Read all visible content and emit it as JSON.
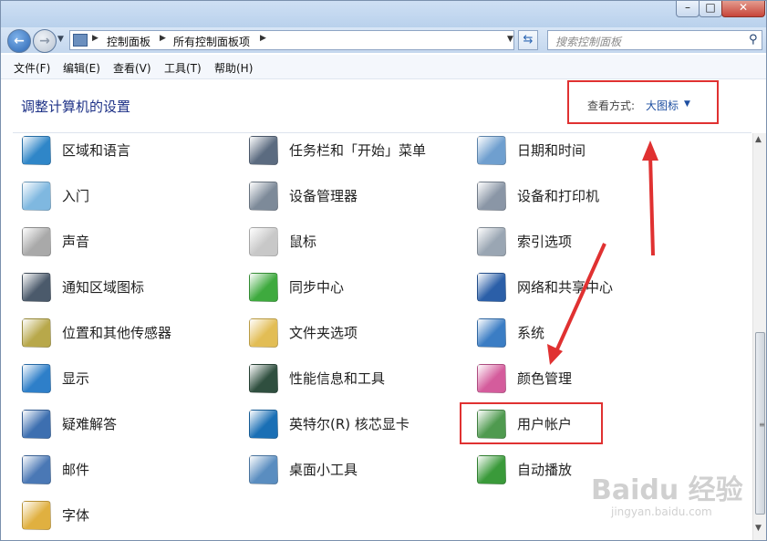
{
  "window": {
    "minimize_label": "–",
    "maximize_label": "□",
    "close_label": "✕"
  },
  "navigation": {
    "back_icon": "back-arrow-icon",
    "forward_icon": "forward-arrow-icon",
    "breadcrumbs": [
      "控制面板",
      "所有控制面板项"
    ],
    "search_placeholder": "搜索控制面板"
  },
  "menu": [
    "文件(F)",
    "编辑(E)",
    "查看(V)",
    "工具(T)",
    "帮助(H)"
  ],
  "header": {
    "title": "调整计算机的设置",
    "view_label": "查看方式:",
    "view_value": "大图标"
  },
  "items": [
    {
      "label": "区域和语言",
      "icon": "globe-clock-icon",
      "color": "#2f86c8"
    },
    {
      "label": "任务栏和「开始」菜单",
      "icon": "taskbar-icon",
      "color": "#5b6b80"
    },
    {
      "label": "日期和时间",
      "icon": "calendar-clock-icon",
      "color": "#6f9fcf"
    },
    {
      "label": "入门",
      "icon": "getting-started-icon",
      "color": "#7fb8e0"
    },
    {
      "label": "设备管理器",
      "icon": "device-manager-icon",
      "color": "#7d8a99"
    },
    {
      "label": "设备和打印机",
      "icon": "printer-icon",
      "color": "#8a96a6"
    },
    {
      "label": "声音",
      "icon": "speaker-icon",
      "color": "#a9a9a9"
    },
    {
      "label": "鼠标",
      "icon": "mouse-icon",
      "color": "#c8c8c8"
    },
    {
      "label": "索引选项",
      "icon": "magnifier-icon",
      "color": "#9aa6b3"
    },
    {
      "label": "通知区域图标",
      "icon": "notification-area-icon",
      "color": "#4b5a6b"
    },
    {
      "label": "同步中心",
      "icon": "sync-icon",
      "color": "#3eaa3e"
    },
    {
      "label": "网络和共享中心",
      "icon": "network-icon",
      "color": "#2b5fa8"
    },
    {
      "label": "位置和其他传感器",
      "icon": "sensor-icon",
      "color": "#b8a84a"
    },
    {
      "label": "文件夹选项",
      "icon": "folder-options-icon",
      "color": "#e2bd55"
    },
    {
      "label": "系统",
      "icon": "system-monitor-icon",
      "color": "#3b7dc4"
    },
    {
      "label": "显示",
      "icon": "display-icon",
      "color": "#2e7fc9"
    },
    {
      "label": "性能信息和工具",
      "icon": "performance-icon",
      "color": "#2f4f3f"
    },
    {
      "label": "颜色管理",
      "icon": "color-management-icon",
      "color": "#d45c9c"
    },
    {
      "label": "疑难解答",
      "icon": "troubleshoot-icon",
      "color": "#3d6fb0"
    },
    {
      "label": "英特尔(R) 核芯显卡",
      "icon": "intel-graphics-icon",
      "color": "#1a6fb5"
    },
    {
      "label": "用户帐户",
      "icon": "user-accounts-icon",
      "color": "#4f9a4f"
    },
    {
      "label": "邮件",
      "icon": "mail-icon",
      "color": "#4a78b5"
    },
    {
      "label": "桌面小工具",
      "icon": "gadgets-icon",
      "color": "#5a8dc0"
    },
    {
      "label": "自动播放",
      "icon": "autoplay-icon",
      "color": "#3a9a3a"
    },
    {
      "label": "字体",
      "icon": "fonts-icon",
      "color": "#e0b040"
    }
  ],
  "colors": {
    "annotation_red": "#e03131",
    "link_blue": "#1e4fa1",
    "title_blue": "#1e3287"
  },
  "watermark": {
    "text": "Baidu 经验",
    "url": "jingyan.baidu.com"
  }
}
